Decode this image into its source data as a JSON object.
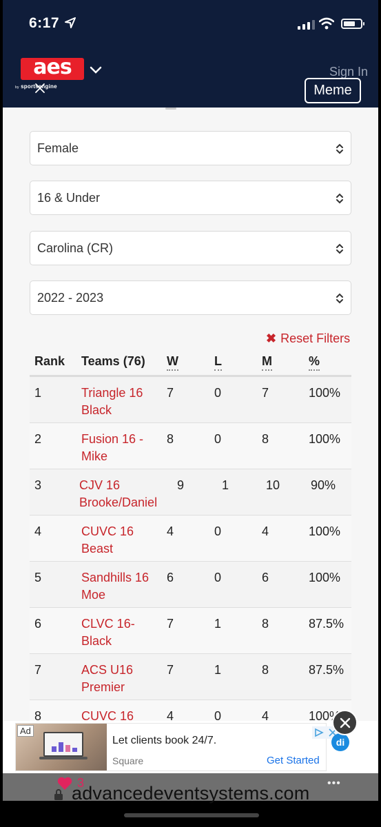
{
  "status_bar": {
    "time": "6:17"
  },
  "header": {
    "logo_text": "aes",
    "logo_sub": "sportsengine",
    "logo_sub_prefix": "by",
    "sign_in": "Sign In",
    "meme_button": "Meme"
  },
  "filters": {
    "gender": "Female",
    "age": "16 & Under",
    "region": "Carolina (CR)",
    "season": "2022 - 2023",
    "reset_label": "Reset Filters"
  },
  "table": {
    "headers": {
      "rank": "Rank",
      "teams": "Teams (76)",
      "w": "W",
      "l": "L",
      "m": "M",
      "pct": "%"
    },
    "rows": [
      {
        "rank": "1",
        "team": "Triangle 16 Black",
        "w": "7",
        "l": "0",
        "m": "7",
        "pct": "100%"
      },
      {
        "rank": "2",
        "team": "Fusion 16 - Mike",
        "w": "8",
        "l": "0",
        "m": "8",
        "pct": "100%"
      },
      {
        "rank": "3",
        "team": "CJV 16 Brooke/Daniel",
        "w": "9",
        "l": "1",
        "m": "10",
        "pct": "90%"
      },
      {
        "rank": "4",
        "team": "CUVC 16 Beast",
        "w": "4",
        "l": "0",
        "m": "4",
        "pct": "100%"
      },
      {
        "rank": "5",
        "team": "Sandhills 16 Moe",
        "w": "6",
        "l": "0",
        "m": "6",
        "pct": "100%"
      },
      {
        "rank": "6",
        "team": "CLVC 16-Black",
        "w": "7",
        "l": "1",
        "m": "8",
        "pct": "87.5%"
      },
      {
        "rank": "7",
        "team": "ACS U16 Premier",
        "w": "7",
        "l": "1",
        "m": "8",
        "pct": "87.5%"
      },
      {
        "rank": "8",
        "team": "CUVC 16",
        "w": "4",
        "l": "0",
        "m": "4",
        "pct": "100%"
      }
    ]
  },
  "ad": {
    "badge": "Ad",
    "title": "Let clients book 24/7.",
    "brand": "Square",
    "cta": "Get Started",
    "di_label": "di"
  },
  "browser": {
    "likes": "3",
    "url": "advancedeventsystems.com",
    "more": "•••"
  },
  "colors": {
    "header_bg": "#0f1d3a",
    "brand_red": "#e8202a",
    "link_red": "#c7252b",
    "cta_blue": "#1a73e8"
  }
}
